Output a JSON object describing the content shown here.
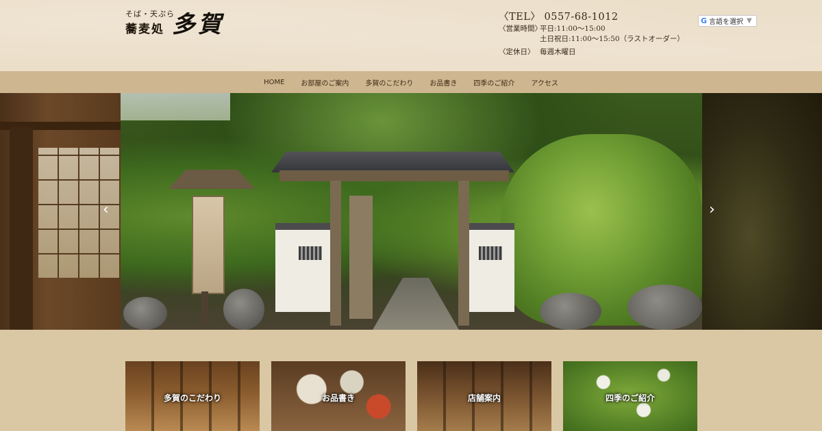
{
  "header": {
    "logo_sub": "そば・天ぷら",
    "logo_kanji": "蕎麦処",
    "logo_name": "多賀",
    "tel": "〈TEL〉 0557-68-1012",
    "hours_label": "〈営業時間〉",
    "hours_weekday": "平日:11:00〜15:00",
    "hours_weekend": "土日祝日:11:00〜15:50（ラストオーダー）",
    "closed_label": "〈定休日〉",
    "closed_value": "毎週木曜日",
    "translate_label": "言語を選択",
    "translate_arrow": "▼",
    "translate_icon": "G"
  },
  "nav": {
    "items": [
      {
        "label": "HOME"
      },
      {
        "label": "お部屋のご案内"
      },
      {
        "label": "多賀のこだわり"
      },
      {
        "label": "お品書き"
      },
      {
        "label": "四季のご紹介"
      },
      {
        "label": "アクセス"
      }
    ]
  },
  "slider": {
    "prev_glyph": "‹",
    "next_glyph": "›"
  },
  "cards": [
    {
      "label": "多賀のこだわり"
    },
    {
      "label": "お品書き"
    },
    {
      "label": "店舗案内"
    },
    {
      "label": "四季のご紹介"
    }
  ],
  "colors": {
    "header_bg": "#ecdfca",
    "nav_bg": "#cdb690",
    "page_bg": "#dac8a4",
    "text": "#3a2a18"
  }
}
